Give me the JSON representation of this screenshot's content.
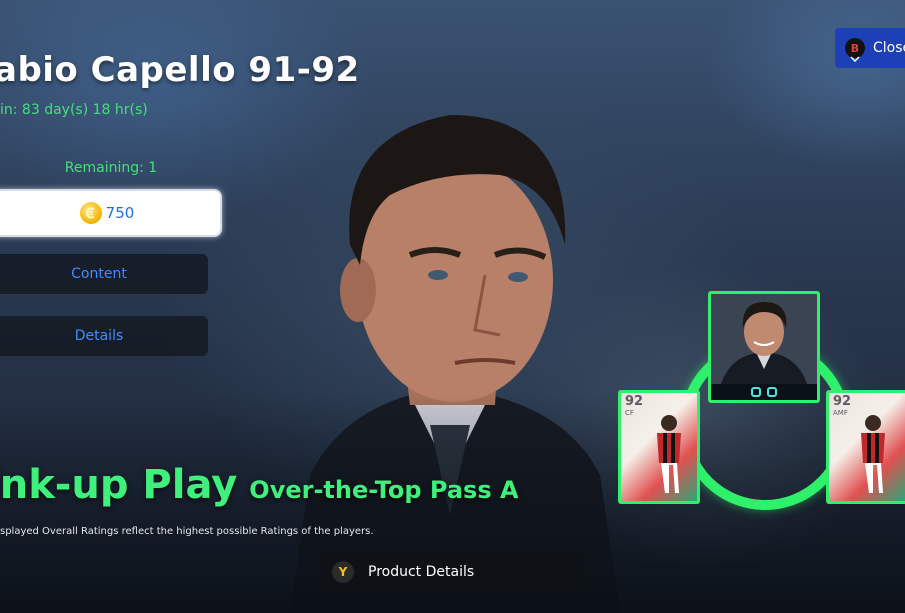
{
  "header": {
    "title": "abio Capello 91-92",
    "timer": " in: 83 day(s) 18 hr(s)"
  },
  "purchase": {
    "remaining": "Remaining: 1",
    "price": "750",
    "currency_icon": "coin-icon"
  },
  "menu": {
    "content_label": "Content",
    "details_label": "Details"
  },
  "close_button": {
    "key": "B",
    "label": "Close"
  },
  "skill": {
    "main": "ink-up Play",
    "sub": "Over-the-Top Pass A"
  },
  "disclaimer": "splayed Overall Ratings reflect the highest possible Ratings of the players.",
  "product_button": {
    "key": "Y",
    "label": "Product Details"
  },
  "link_up": {
    "player_cards": [
      {
        "rating": "92",
        "position": "CF"
      },
      {
        "rating": "92",
        "position": "AMF"
      }
    ]
  },
  "colors": {
    "accent_green": "#3ff07c",
    "link_blue": "#3d8dff",
    "close_blue": "#1d3fb8"
  }
}
